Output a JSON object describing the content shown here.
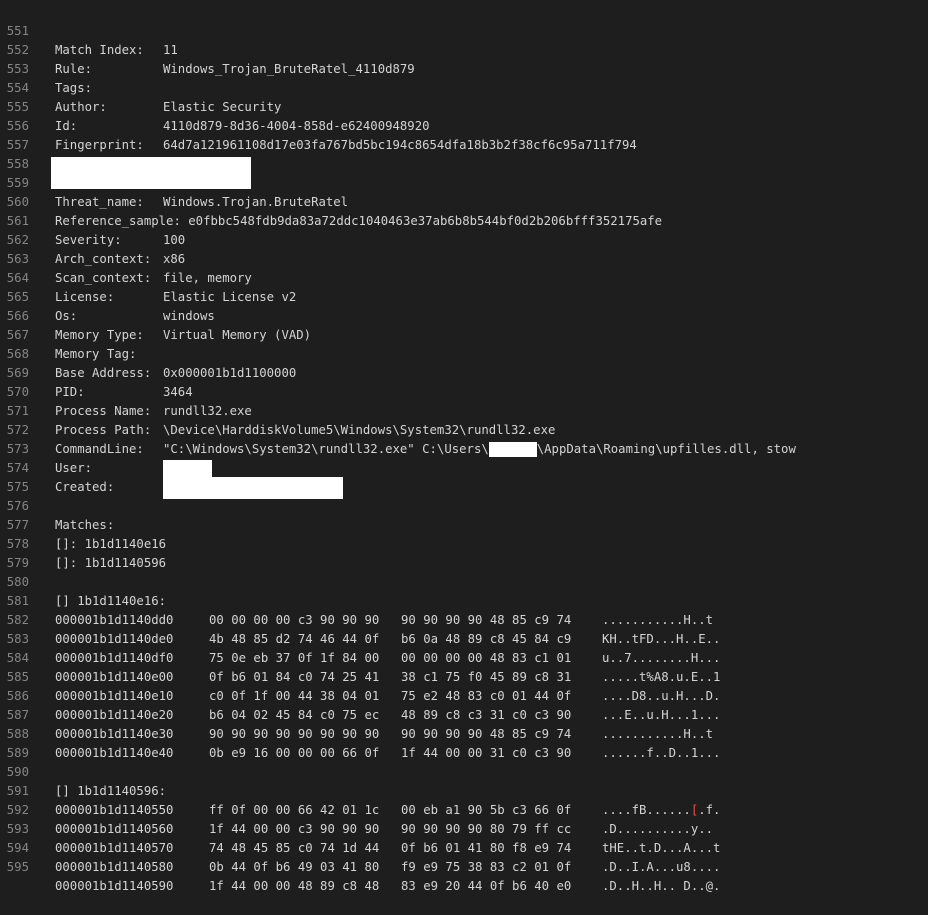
{
  "editor": {
    "lines": [
      {
        "n": "551",
        "key": "Match Index:",
        "val": "11"
      },
      {
        "n": "552",
        "key": "Rule:",
        "val": "Windows_Trojan_BruteRatel_4110d879"
      },
      {
        "n": "553",
        "key": "Tags:",
        "val": ""
      },
      {
        "n": "554",
        "key": "Author:",
        "val": "Elastic Security"
      },
      {
        "n": "555",
        "key": "Id:",
        "val": "4110d879-8d36-4004-858d-e62400948920"
      },
      {
        "n": "556",
        "key": "Fingerprint:",
        "val": "64d7a121961108d17e03fa767bd5bc194c8654dfa18b3b2f38cf6c95a711f794"
      },
      {
        "n": "557",
        "key": "",
        "val": ""
      },
      {
        "n": "558",
        "key": "",
        "val": ""
      },
      {
        "n": "559",
        "key": "Threat_name:",
        "val": "Windows.Trojan.BruteRatel"
      },
      {
        "n": "560",
        "key": "Reference_sample:",
        "val": "e0fbbc548fdb9da83a72ddc1040463e37ab6b8b544bf0d2b206bfff352175afe"
      },
      {
        "n": "561",
        "key": "Severity:",
        "val": "100"
      },
      {
        "n": "562",
        "key": "Arch_context:",
        "val": "x86"
      },
      {
        "n": "563",
        "key": "Scan_context:",
        "val": "file, memory"
      },
      {
        "n": "564",
        "key": "License:",
        "val": "Elastic License v2"
      },
      {
        "n": "565",
        "key": "Os:",
        "val": "windows"
      },
      {
        "n": "566",
        "key": "Memory Type:",
        "val": "Virtual Memory (VAD)"
      },
      {
        "n": "567",
        "key": "Memory Tag:",
        "val": ""
      },
      {
        "n": "568",
        "key": "Base Address:",
        "val": "0x000001b1d1100000"
      },
      {
        "n": "569",
        "key": "PID:",
        "val": "3464"
      },
      {
        "n": "570",
        "key": "Process Name:",
        "val": "rundll32.exe"
      },
      {
        "n": "571",
        "key": "Process Path:",
        "val": "\\Device\\HarddiskVolume5\\Windows\\System32\\rundll32.exe"
      },
      {
        "n": "572",
        "key": "CommandLine:",
        "val_a": "\"C:\\Windows\\System32\\rundll32.exe\" C:\\Users\\",
        "val_b": "\\AppData\\Roaming\\upfilles.dll, stow"
      },
      {
        "n": "573",
        "key": "User:",
        "val": ""
      },
      {
        "n": "574",
        "key": "Created:",
        "val": ""
      },
      {
        "n": "575",
        "text": ""
      },
      {
        "n": "576",
        "text": "Matches:"
      },
      {
        "n": "577",
        "text": "[]: 1b1d1140e16"
      },
      {
        "n": "578",
        "text": "[]: 1b1d1140596"
      },
      {
        "n": "579",
        "text": ""
      },
      {
        "n": "580",
        "text": "[] 1b1d1140e16:"
      },
      {
        "n": "581",
        "addr": "000001b1d1140dd0",
        "a": "00 00 00 00 c3 90 90 90",
        "b": "90 90 90 90 48 85 c9 74",
        "ascii": "...........H..t"
      },
      {
        "n": "582",
        "addr": "000001b1d1140de0",
        "a": "4b 48 85 d2 74 46 44 0f",
        "b": "b6 0a 48 89 c8 45 84 c9",
        "ascii": "KH..tFD...H..E.."
      },
      {
        "n": "583",
        "addr": "000001b1d1140df0",
        "a": "75 0e eb 37 0f 1f 84 00",
        "b": "00 00 00 00 48 83 c1 01",
        "ascii": "u..7........H..."
      },
      {
        "n": "584",
        "addr": "000001b1d1140e00",
        "a": "0f b6 01 84 c0 74 25 41",
        "b": "38 c1 75 f0 45 89 c8 31",
        "ascii": ".....t%A8.u.E..1"
      },
      {
        "n": "585",
        "addr": "000001b1d1140e10",
        "a": "c0 0f 1f 00 44 38 04 01",
        "b": "75 e2 48 83 c0 01 44 0f",
        "ascii": "....D8..u.H...D."
      },
      {
        "n": "586",
        "addr": "000001b1d1140e20",
        "a": "b6 04 02 45 84 c0 75 ec",
        "b": "48 89 c8 c3 31 c0 c3 90",
        "ascii": "...E..u.H...1..."
      },
      {
        "n": "587",
        "addr": "000001b1d1140e30",
        "a": "90 90 90 90 90 90 90 90",
        "b": "90 90 90 90 48 85 c9 74",
        "ascii": "...........H..t"
      },
      {
        "n": "588",
        "addr": "000001b1d1140e40",
        "a": "0b e9 16 00 00 00 66 0f",
        "b": "1f 44 00 00 31 c0 c3 90",
        "ascii": "......f..D..1..."
      },
      {
        "n": "589",
        "text": ""
      },
      {
        "n": "590",
        "text": "[] 1b1d1140596:"
      },
      {
        "n": "591",
        "addr": "000001b1d1140550",
        "a": "ff 0f 00 00 66 42 01 1c",
        "b": "00 eb a1 90 5b c3 66 0f",
        "ascii_a": "....fB......",
        "ascii_red": "[",
        "ascii_b": ".f."
      },
      {
        "n": "592",
        "addr": "000001b1d1140560",
        "a": "1f 44 00 00 c3 90 90 90",
        "b": "90 90 90 90 80 79 ff cc",
        "ascii": ".D..........y.."
      },
      {
        "n": "593",
        "addr": "000001b1d1140570",
        "a": "74 48 45 85 c0 74 1d 44",
        "b": "0f b6 01 41 80 f8 e9 74",
        "ascii": "tHE..t.D...A...t"
      },
      {
        "n": "594",
        "addr": "000001b1d1140580",
        "a": "0b 44 0f b6 49 03 41 80",
        "b": "f9 e9 75 38 83 c2 01 0f",
        "ascii": ".D..I.A...u8...."
      },
      {
        "n": "595",
        "addr": "000001b1d1140590",
        "a": "1f 44 00 00 48 89 c8 48",
        "b": "83 e9 20 44 0f b6 40 e0",
        "ascii": ".D..H..H.. D..@."
      }
    ]
  },
  "colors": {
    "background": "#1e1e1e",
    "text": "#d4d4d4",
    "line_number": "#858585",
    "redaction": "#ffffff",
    "highlight_char": "#f14c4c"
  }
}
